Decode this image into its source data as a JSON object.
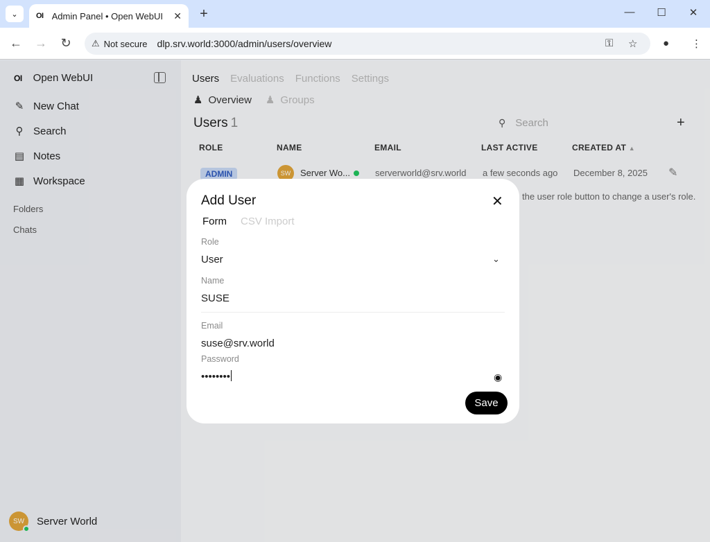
{
  "browser": {
    "tab_title": "Admin Panel • Open WebUI",
    "tab_favicon": "OI",
    "security_label": "Not secure",
    "url": "dlp.srv.world:3000/admin/users/overview"
  },
  "sidebar": {
    "logo": "OI",
    "app_name": "Open WebUI",
    "items": [
      {
        "label": "New Chat",
        "icon": "pencil-square-icon"
      },
      {
        "label": "Search",
        "icon": "search-icon"
      },
      {
        "label": "Notes",
        "icon": "notes-icon"
      },
      {
        "label": "Workspace",
        "icon": "grid-icon"
      }
    ],
    "sections": [
      "Folders",
      "Chats"
    ],
    "user": {
      "initials": "SW",
      "name": "Server World"
    }
  },
  "main": {
    "tabs": [
      "Users",
      "Evaluations",
      "Functions",
      "Settings"
    ],
    "subtabs": [
      "Overview",
      "Groups"
    ],
    "users_title": "Users",
    "users_count": "1",
    "search_placeholder": "Search",
    "columns": [
      "ROLE",
      "NAME",
      "EMAIL",
      "LAST ACTIVE",
      "CREATED AT"
    ],
    "rows": [
      {
        "role": "ADMIN",
        "initials": "SW",
        "name": "Server Wo...",
        "email": "serverworld@srv.world",
        "last_active": "a few seconds ago",
        "created_at": "December 8, 2025"
      }
    ],
    "hint": "the user role button to change a user's role."
  },
  "modal": {
    "title": "Add User",
    "tabs": [
      "Form",
      "CSV Import"
    ],
    "role_label": "Role",
    "role_value": "User",
    "name_label": "Name",
    "name_value": "SUSE",
    "email_label": "Email",
    "email_value": "suse@srv.world",
    "password_label": "Password",
    "password_value": "••••••••",
    "save_label": "Save"
  },
  "colors": {
    "accent": "#000000",
    "admin_badge_bg": "#c9d9f4",
    "admin_badge_text": "#2f5bbf",
    "online": "#22c55e",
    "avatar": "#e0a43a"
  }
}
